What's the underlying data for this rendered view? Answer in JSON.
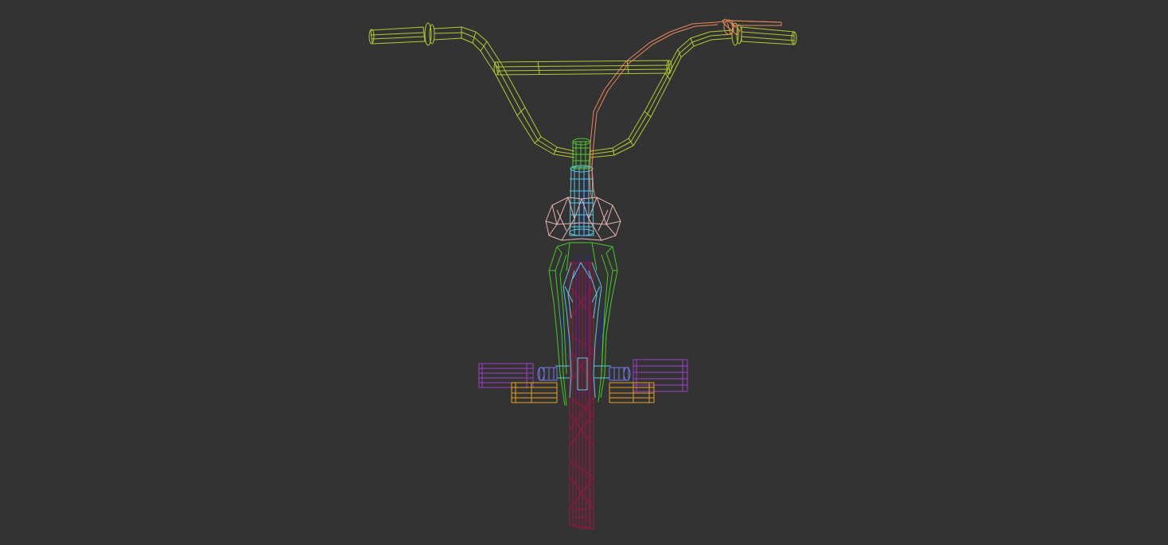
{
  "viewport": {
    "background": "#333333",
    "render_mode": "wireframe",
    "view": "front"
  },
  "model": {
    "subject": "BMX bicycle",
    "parts": [
      {
        "name": "handlebar",
        "color": "#b4c832"
      },
      {
        "name": "brake-cable",
        "color": "#e8885a"
      },
      {
        "name": "stem",
        "color": "#4ec832"
      },
      {
        "name": "fork",
        "color": "#46c82a"
      },
      {
        "name": "seat",
        "color": "#e8b4b4"
      },
      {
        "name": "head-tube",
        "color": "#5ac8e6"
      },
      {
        "name": "front-wheel",
        "color": "#a01446"
      },
      {
        "name": "frame-detail",
        "color": "#1e1eb4"
      },
      {
        "name": "pegs",
        "color": "#a03cc8"
      },
      {
        "name": "axle-nuts",
        "color": "#e6a028"
      },
      {
        "name": "hub",
        "color": "#7878e6"
      }
    ]
  }
}
